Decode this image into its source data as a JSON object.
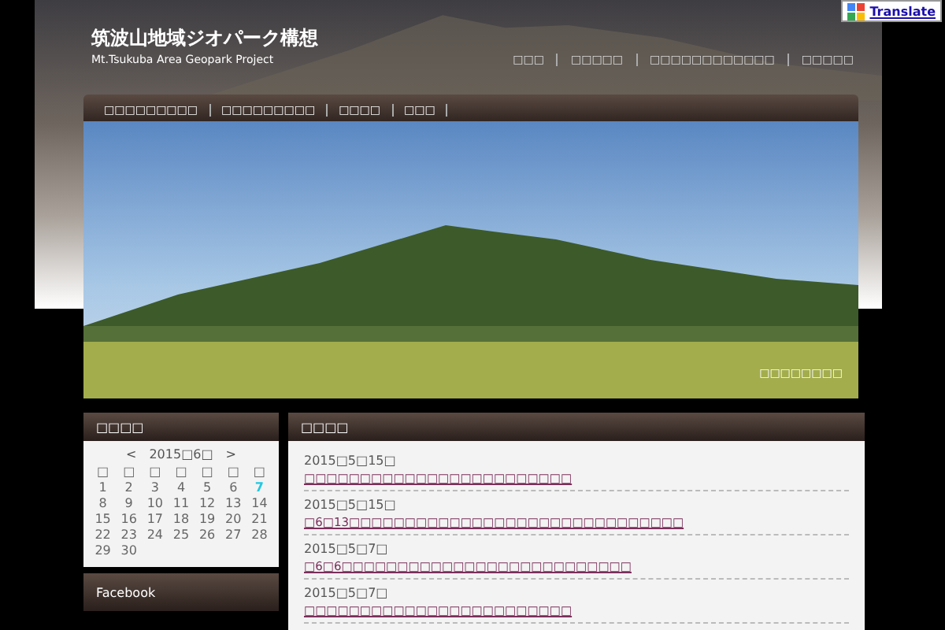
{
  "translate": {
    "label": "Translate"
  },
  "site": {
    "title": "筑波山地域ジオパーク構想",
    "subtitle": "Mt.Tsukuba Area Geopark Project"
  },
  "top_nav": [
    "□□□",
    "□□□□□",
    "□□□□□□□□□□□□",
    "□□□□□"
  ],
  "main_menu": [
    "□□□□□□□□□",
    "□□□□□□□□□",
    "□□□□",
    "□□□"
  ],
  "hero": {
    "caption": "□□□□□□□□"
  },
  "calendar": {
    "title": "□□□□",
    "prev": "<",
    "month": "2015□6□",
    "next": ">",
    "weekdays": [
      "□",
      "□",
      "□",
      "□",
      "□",
      "□",
      "□"
    ],
    "weeks": [
      [
        {
          "day": "1",
          "selected": false
        },
        {
          "day": "2",
          "selected": false
        },
        {
          "day": "3",
          "selected": false
        },
        {
          "day": "4",
          "selected": false
        },
        {
          "day": "5",
          "selected": false
        },
        {
          "day": "6",
          "selected": false
        },
        {
          "day": "7",
          "selected": true
        }
      ],
      [
        {
          "day": "8",
          "selected": false
        },
        {
          "day": "9",
          "selected": false
        },
        {
          "day": "10",
          "selected": false
        },
        {
          "day": "11",
          "selected": false
        },
        {
          "day": "12",
          "selected": false
        },
        {
          "day": "13",
          "selected": false
        },
        {
          "day": "14",
          "selected": false
        }
      ],
      [
        {
          "day": "15",
          "selected": false
        },
        {
          "day": "16",
          "selected": false
        },
        {
          "day": "17",
          "selected": false
        },
        {
          "day": "18",
          "selected": false
        },
        {
          "day": "19",
          "selected": false
        },
        {
          "day": "20",
          "selected": false
        },
        {
          "day": "21",
          "selected": false
        }
      ],
      [
        {
          "day": "22",
          "selected": false
        },
        {
          "day": "23",
          "selected": false
        },
        {
          "day": "24",
          "selected": false
        },
        {
          "day": "25",
          "selected": false
        },
        {
          "day": "26",
          "selected": false
        },
        {
          "day": "27",
          "selected": false
        },
        {
          "day": "28",
          "selected": false
        }
      ],
      [
        {
          "day": "29",
          "selected": false
        },
        {
          "day": "30",
          "selected": false
        }
      ]
    ]
  },
  "facebook": {
    "title": "Facebook"
  },
  "news": {
    "title": "□□□□",
    "items": [
      {
        "date": "2015□5□15□",
        "link": "□□□□□□□□□□□□□□□□□□□□□□□□"
      },
      {
        "date": "2015□5□15□",
        "link": "□6□13□□□□□□□□□□□□□□□□□□□□□□□□□□□□□□"
      },
      {
        "date": "2015□5□7□",
        "link": "□6□6□□□□□□□□□□□□□□□□□□□□□□□□□□"
      },
      {
        "date": "2015□5□7□",
        "link": "□□□□□□□□□□□□□□□□□□□□□□□□"
      }
    ]
  }
}
